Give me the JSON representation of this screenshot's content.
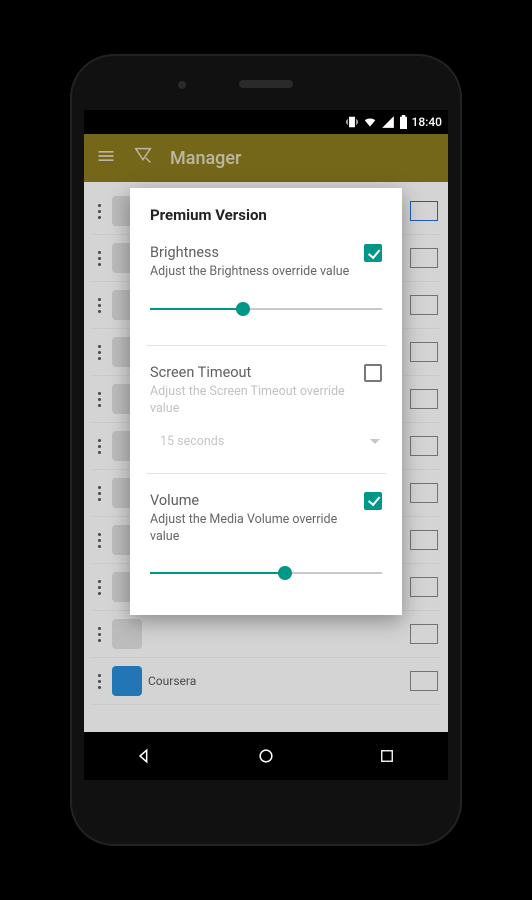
{
  "statusbar": {
    "time": "18:40"
  },
  "appbar": {
    "title": "Manager"
  },
  "background": {
    "rows": [
      {
        "name": ""
      },
      {
        "name": ""
      },
      {
        "name": ""
      },
      {
        "name": ""
      },
      {
        "name": ""
      },
      {
        "name": ""
      },
      {
        "name": ""
      },
      {
        "name": ""
      },
      {
        "name": ""
      },
      {
        "name": ""
      },
      {
        "name": "Coursera"
      }
    ]
  },
  "dialog": {
    "title": "Premium Version",
    "brightness": {
      "title": "Brightness",
      "subtitle": "Adjust the Brightness override value",
      "checked": true,
      "slider_percent": 40
    },
    "timeout": {
      "title": "Screen Timeout",
      "subtitle": "Adjust the Screen Timeout override value",
      "checked": false,
      "selected": "15 seconds"
    },
    "volume": {
      "title": "Volume",
      "subtitle": "Adjust the Media Volume override value",
      "checked": true,
      "slider_percent": 58
    }
  },
  "colors": {
    "accent": "#009688",
    "appbar": "#8a7a1e"
  }
}
